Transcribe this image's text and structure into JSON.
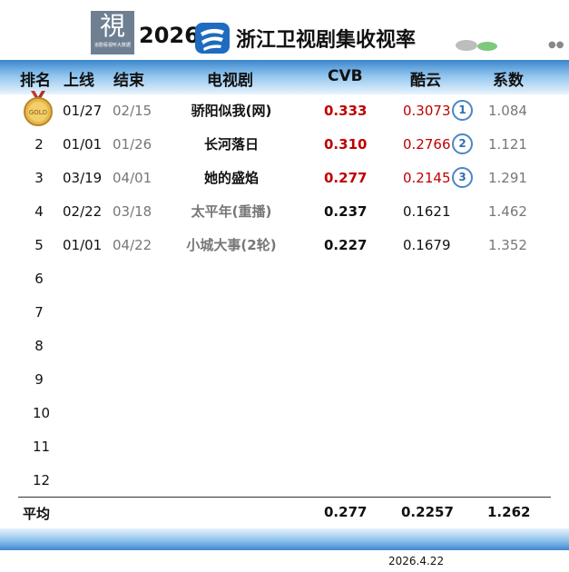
{
  "banner": {
    "logo_char": "視",
    "logo_caption": "追剧看视听大数据",
    "year": "2026",
    "title": "浙江卫视剧集收视率",
    "logo_color": "#1f6bbf"
  },
  "columns": [
    "排名",
    "上线",
    "结束",
    "电视剧",
    "CVB",
    "酷云",
    "系数"
  ],
  "rows": [
    {
      "rank": "",
      "medal_text": "GOLD",
      "start": "01/27",
      "end": "02/15",
      "drama": "骄阳似我(网)",
      "cvb": "0.333",
      "kuyun": "0.3073",
      "kuyun_rank": "1",
      "coef": "1.084"
    },
    {
      "rank": "2",
      "start": "01/01",
      "end": "01/26",
      "drama": "长河落日",
      "cvb": "0.310",
      "kuyun": "0.2766",
      "kuyun_rank": "2",
      "coef": "1.121"
    },
    {
      "rank": "3",
      "start": "03/19",
      "end": "04/01",
      "drama": "她的盛焰",
      "cvb": "0.277",
      "kuyun": "0.2145",
      "kuyun_rank": "3",
      "coef": "1.291"
    },
    {
      "rank": "4",
      "start": "02/22",
      "end": "03/18",
      "drama": "太平年(重播)",
      "cvb": "0.237",
      "kuyun": "0.1621",
      "coef": "1.462"
    },
    {
      "rank": "5",
      "start": "01/01",
      "end": "04/22",
      "drama": "小城大事(2轮)",
      "cvb": "0.227",
      "kuyun": "0.1679",
      "coef": "1.352"
    },
    {
      "rank": "6"
    },
    {
      "rank": "7"
    },
    {
      "rank": "8"
    },
    {
      "rank": "9"
    },
    {
      "rank": "10"
    },
    {
      "rank": "11"
    },
    {
      "rank": "12"
    }
  ],
  "average": {
    "label": "平均",
    "cvb": "0.277",
    "kuyun": "0.2257",
    "coef": "1.262"
  },
  "footer": {
    "date": "2026.4.22"
  },
  "colors": {
    "highlight_red": "#c00000",
    "header_blue": "#3b87cc",
    "muted_gray": "#777777"
  }
}
